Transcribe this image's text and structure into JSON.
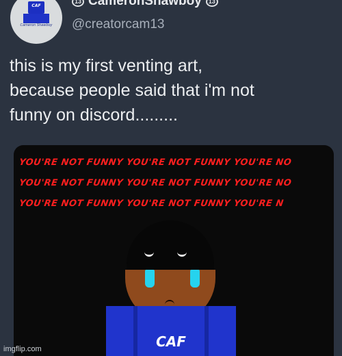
{
  "profile": {
    "display_name": "CameronShawboy",
    "badge_left": "13",
    "badge_right": "13",
    "handle": "@creatorcam13",
    "avatar_label": "CAF",
    "avatar_caption": "Cameron Shawboy"
  },
  "tweet": {
    "lines": [
      "this is my first venting art,",
      "because people said that i'm not",
      "funny on discord........."
    ]
  },
  "image": {
    "banner_rows": [
      "YOU'RE NOT FUNNY  YOU'RE NOT FUNNY  YOU'RE NO",
      "YOU'RE NOT FUNNY  YOU'RE NOT FUNNY  YOU'RE NO",
      "YOU'RE NOT FUNNY   YOU'RE NOT FUNNY   YOU'RE N"
    ],
    "shirt_text": "CAF",
    "colors": {
      "banner_text": "#ff1f1f",
      "shirt": "#2034cc",
      "tears": "#26d3ee",
      "skin": "#8f4a1d"
    }
  },
  "watermark": "imgflip.com"
}
